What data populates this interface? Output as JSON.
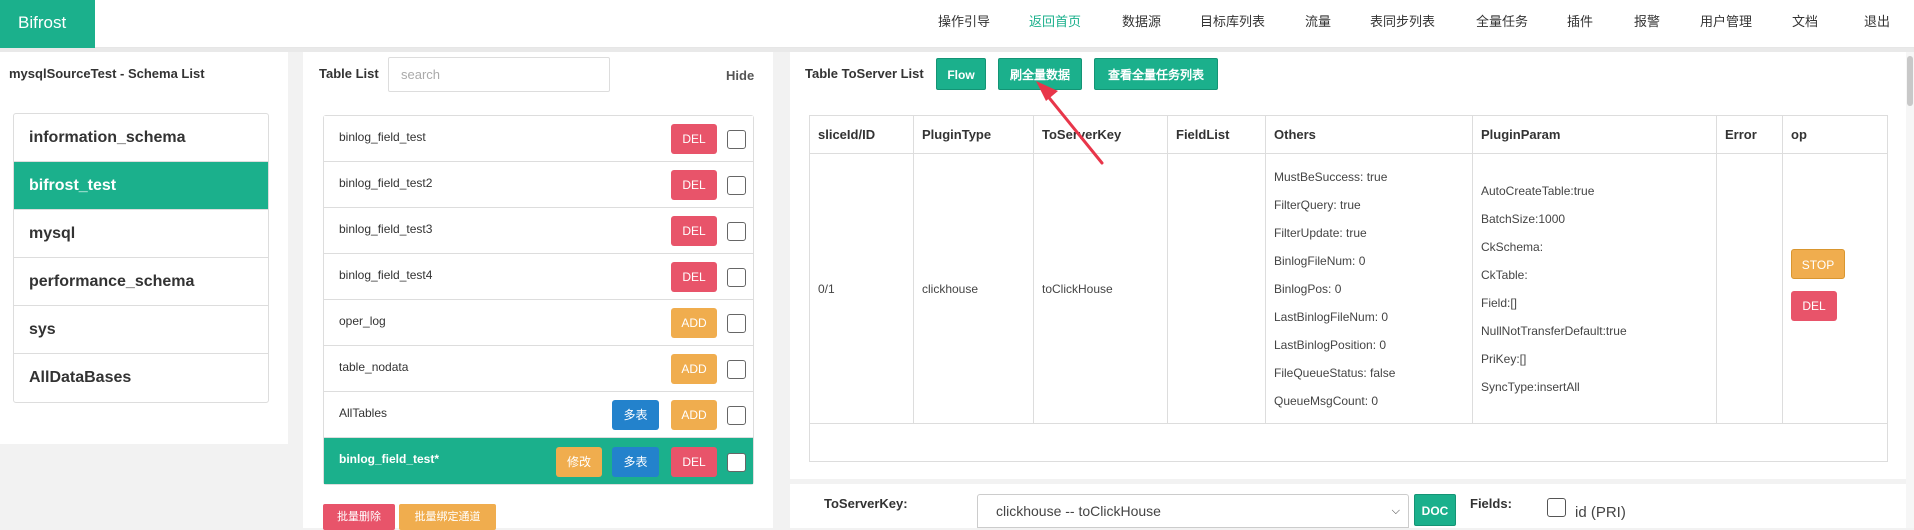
{
  "nav": {
    "brand": "Bifrost",
    "items": [
      {
        "label": "操作引导",
        "active": false
      },
      {
        "label": "返回首页",
        "active": true
      },
      {
        "label": "数据源",
        "active": false
      },
      {
        "label": "目标库列表",
        "active": false
      },
      {
        "label": "流量",
        "active": false
      },
      {
        "label": "表同步列表",
        "active": false
      },
      {
        "label": "全量任务",
        "active": false
      },
      {
        "label": "插件",
        "active": false
      },
      {
        "label": "报警",
        "active": false
      },
      {
        "label": "用户管理",
        "active": false
      },
      {
        "label": "文档",
        "active": false
      },
      {
        "label": "退出",
        "active": false
      }
    ]
  },
  "schema": {
    "title": "mysqlSourceTest - Schema List",
    "items": [
      "information_schema",
      "bifrost_test",
      "mysql",
      "performance_schema",
      "sys",
      "AllDataBases"
    ],
    "active_index": 1
  },
  "tables": {
    "title": "Table List",
    "search_placeholder": "search",
    "hide_label": "Hide",
    "rows": [
      {
        "name": "binlog_field_test",
        "modify": "",
        "multi": "",
        "action": "DEL"
      },
      {
        "name": "binlog_field_test2",
        "modify": "",
        "multi": "",
        "action": "DEL"
      },
      {
        "name": "binlog_field_test3",
        "modify": "",
        "multi": "",
        "action": "DEL"
      },
      {
        "name": "binlog_field_test4",
        "modify": "",
        "multi": "",
        "action": "DEL"
      },
      {
        "name": "oper_log",
        "modify": "",
        "multi": "",
        "action": "ADD"
      },
      {
        "name": "table_nodata",
        "modify": "",
        "multi": "",
        "action": "ADD"
      },
      {
        "name": "AllTables",
        "modify": "",
        "multi": "多表",
        "action": "ADD"
      },
      {
        "name": "binlog_field_test*",
        "modify": "修改",
        "multi": "多表",
        "action": "DEL"
      }
    ],
    "active_index": 7,
    "batch_delete": "批量删除",
    "batch_bind": "批量绑定通道"
  },
  "toserver": {
    "title": "Table ToServer List",
    "flow_btn": "Flow",
    "full_data_btn": "刷全量数据",
    "view_tasks_btn": "查看全量任务列表",
    "columns": [
      "sliceId/ID",
      "PluginType",
      "ToServerKey",
      "FieldList",
      "Others",
      "PluginParam",
      "Error",
      "op"
    ],
    "row": {
      "slice_id": "0/1",
      "plugin_type": "clickhouse",
      "to_server_key": "toClickHouse",
      "field_list": "",
      "others": [
        "MustBeSuccess: true",
        "FilterQuery: true",
        "FilterUpdate: true",
        "BinlogFileNum: 0",
        "BinlogPos: 0",
        "LastBinlogFileNum: 0",
        "LastBinlogPosition: 0",
        "FileQueueStatus: false",
        "QueueMsgCount: 0"
      ],
      "plugin_param": [
        "AutoCreateTable:true",
        "BatchSize:1000",
        "CkSchema:",
        "CkTable:",
        "Field:[]",
        "NullNotTransferDefault:true",
        "PriKey:[]",
        "SyncType:insertAll"
      ],
      "error": "",
      "stop_btn": "STOP",
      "del_btn": "DEL"
    }
  },
  "form": {
    "to_server_key_label": "ToServerKey:",
    "to_server_key_value": "clickhouse -- toClickHouse",
    "doc_btn": "DOC",
    "fields_label": "Fields:",
    "field_option": "id (PRI)"
  },
  "colors": {
    "accent": "#1bb08c",
    "danger": "#e8546a",
    "warning": "#f0ad4e",
    "primary": "#2382cc",
    "annotation_arrow": "#e8364a"
  }
}
